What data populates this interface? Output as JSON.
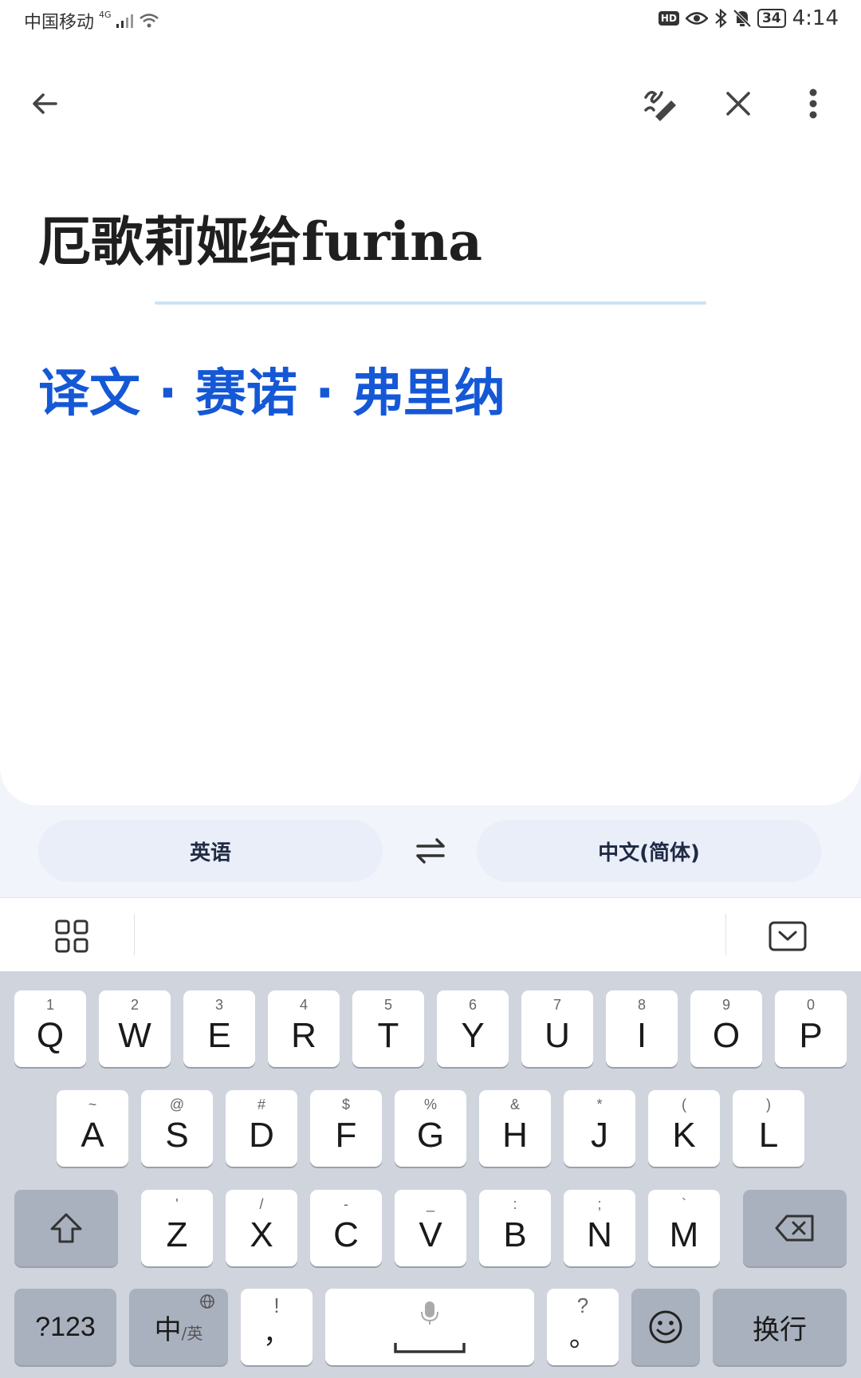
{
  "status_bar": {
    "carrier": "中国移动",
    "network": "4G",
    "hd": "HD",
    "battery": "34",
    "time": "4:14"
  },
  "translation": {
    "source_text": "厄歌莉娅给furina",
    "translated_text": "译文 · 赛诺 · 弗里纳"
  },
  "languages": {
    "source": "英语",
    "target": "中文(简体)"
  },
  "keyboard": {
    "row1": [
      {
        "key": "Q",
        "hint": "1"
      },
      {
        "key": "W",
        "hint": "2"
      },
      {
        "key": "E",
        "hint": "3"
      },
      {
        "key": "R",
        "hint": "4"
      },
      {
        "key": "T",
        "hint": "5"
      },
      {
        "key": "Y",
        "hint": "6"
      },
      {
        "key": "U",
        "hint": "7"
      },
      {
        "key": "I",
        "hint": "8"
      },
      {
        "key": "O",
        "hint": "9"
      },
      {
        "key": "P",
        "hint": "0"
      }
    ],
    "row2": [
      {
        "key": "A",
        "hint": "~"
      },
      {
        "key": "S",
        "hint": "@"
      },
      {
        "key": "D",
        "hint": "#"
      },
      {
        "key": "F",
        "hint": "$"
      },
      {
        "key": "G",
        "hint": "%"
      },
      {
        "key": "H",
        "hint": "&"
      },
      {
        "key": "J",
        "hint": "*"
      },
      {
        "key": "K",
        "hint": "("
      },
      {
        "key": "L",
        "hint": ")"
      }
    ],
    "row3": [
      {
        "key": "Z",
        "hint": "'"
      },
      {
        "key": "X",
        "hint": "/"
      },
      {
        "key": "C",
        "hint": "-"
      },
      {
        "key": "V",
        "hint": "_"
      },
      {
        "key": "B",
        "hint": ":"
      },
      {
        "key": "N",
        "hint": ";"
      },
      {
        "key": "M",
        "hint": "`"
      }
    ],
    "numbers_label": "?123",
    "lang_switch_main": "中",
    "lang_switch_sub": "/英",
    "comma_key": "，",
    "comma_hint": "!",
    "period_key": "。",
    "period_hint": "?",
    "enter_label": "换行"
  },
  "colors": {
    "accent": "#1558d6",
    "divider": "#c8e3f6",
    "keyboard_bg": "#d0d4dd",
    "dark_key": "#aab1be"
  }
}
